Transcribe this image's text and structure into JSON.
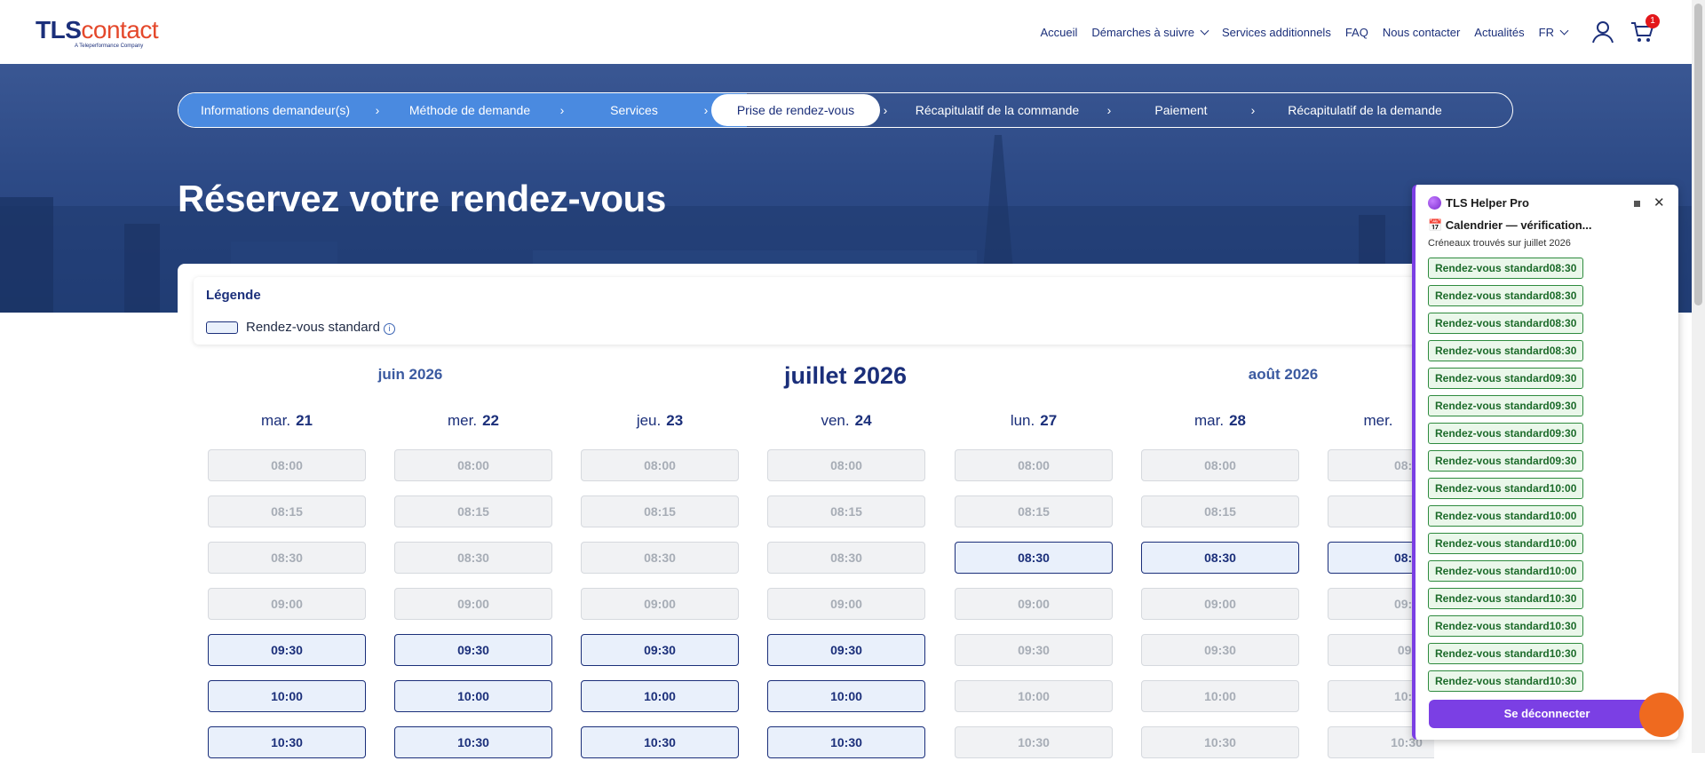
{
  "header": {
    "logo_main": "TLS",
    "logo_sub": "contact",
    "logo_tagline": "A Teleperformance Company",
    "nav": [
      "Accueil",
      "Démarches à suivre",
      "Services additionnels",
      "FAQ",
      "Nous contacter",
      "Actualités",
      "FR"
    ],
    "cart_count": "1"
  },
  "stepper": {
    "steps": [
      "Informations demandeur(s)",
      "Méthode de demande",
      "Services",
      "Prise de rendez-vous",
      "Récapitulatif de la commande",
      "Paiement",
      "Récapitulatif de la demande"
    ],
    "active_index": 3,
    "separator": "›"
  },
  "page_title": "Réservez votre rendez-vous",
  "legend": {
    "title": "Légende",
    "item": "Rendez-vous standard",
    "info": "i"
  },
  "months": {
    "prev": "juin 2026",
    "current": "juillet 2026",
    "next": "août 2026"
  },
  "days": [
    {
      "name": "mar.",
      "num": "21",
      "slots": [
        [
          "08:00",
          false
        ],
        [
          "08:15",
          false
        ],
        [
          "08:30",
          false
        ],
        [
          "09:00",
          false
        ],
        [
          "09:30",
          true
        ],
        [
          "10:00",
          true
        ],
        [
          "10:30",
          true
        ]
      ]
    },
    {
      "name": "mer.",
      "num": "22",
      "slots": [
        [
          "08:00",
          false
        ],
        [
          "08:15",
          false
        ],
        [
          "08:30",
          false
        ],
        [
          "09:00",
          false
        ],
        [
          "09:30",
          true
        ],
        [
          "10:00",
          true
        ],
        [
          "10:30",
          true
        ]
      ]
    },
    {
      "name": "jeu.",
      "num": "23",
      "slots": [
        [
          "08:00",
          false
        ],
        [
          "08:15",
          false
        ],
        [
          "08:30",
          false
        ],
        [
          "09:00",
          false
        ],
        [
          "09:30",
          true
        ],
        [
          "10:00",
          true
        ],
        [
          "10:30",
          true
        ]
      ]
    },
    {
      "name": "ven.",
      "num": "24",
      "slots": [
        [
          "08:00",
          false
        ],
        [
          "08:15",
          false
        ],
        [
          "08:30",
          false
        ],
        [
          "09:00",
          false
        ],
        [
          "09:30",
          true
        ],
        [
          "10:00",
          true
        ],
        [
          "10:30",
          true
        ]
      ]
    },
    {
      "name": "lun.",
      "num": "27",
      "slots": [
        [
          "08:00",
          false
        ],
        [
          "08:15",
          false
        ],
        [
          "08:30",
          true
        ],
        [
          "09:00",
          false
        ],
        [
          "09:30",
          false
        ],
        [
          "10:00",
          false
        ],
        [
          "10:30",
          false
        ]
      ]
    },
    {
      "name": "mar.",
      "num": "28",
      "slots": [
        [
          "08:00",
          false
        ],
        [
          "08:15",
          false
        ],
        [
          "08:30",
          true
        ],
        [
          "09:00",
          false
        ],
        [
          "09:30",
          false
        ],
        [
          "10:00",
          false
        ],
        [
          "10:30",
          false
        ]
      ]
    },
    {
      "name": "mer.",
      "num": "",
      "slots": [
        [
          "08:0",
          false
        ],
        [
          "",
          false
        ],
        [
          "08:3",
          true
        ],
        [
          "09:0",
          false
        ],
        [
          "09:",
          false
        ],
        [
          "10:0",
          false
        ],
        [
          "10:30",
          false
        ]
      ]
    }
  ],
  "helper": {
    "title": "TLS Helper Pro",
    "status": "📅 Calendrier — vérification...",
    "found": "Créneaux trouvés sur juillet 2026",
    "chips": [
      "Rendez-vous standard08:30",
      "Rendez-vous standard08:30",
      "Rendez-vous standard08:30",
      "Rendez-vous standard08:30",
      "Rendez-vous standard09:30",
      "Rendez-vous standard09:30",
      "Rendez-vous standard09:30",
      "Rendez-vous standard09:30",
      "Rendez-vous standard10:00",
      "Rendez-vous standard10:00",
      "Rendez-vous standard10:00",
      "Rendez-vous standard10:00",
      "Rendez-vous standard10:30",
      "Rendez-vous standard10:30",
      "Rendez-vous standard10:30",
      "Rendez-vous standard10:30"
    ],
    "logout": "Se déconnecter",
    "close": "✕"
  },
  "colors": {
    "brand": "#1b2f7a",
    "accent": "#e4482b",
    "helper": "#7b3fe4",
    "available": "#1b2f7a",
    "chip_green": "#2e8b3e"
  }
}
